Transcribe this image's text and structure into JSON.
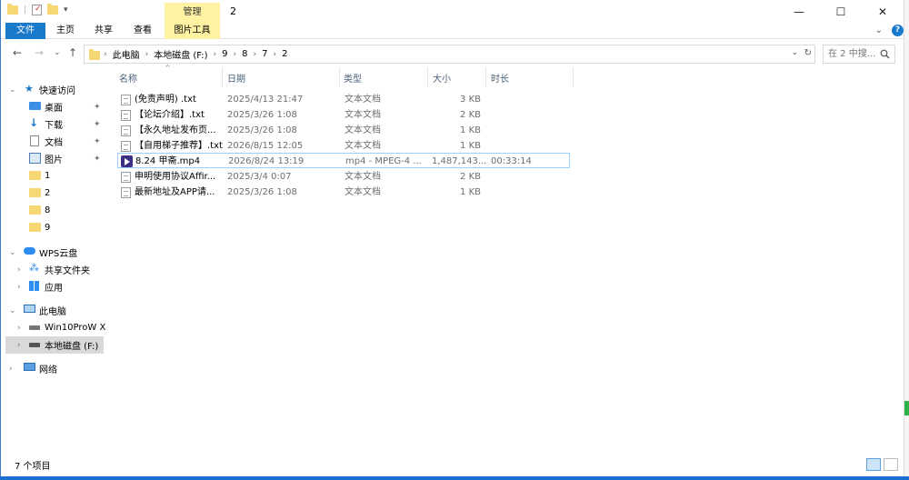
{
  "titlebar": {
    "context_tab_head": "管理",
    "title": "2",
    "minimize": "—",
    "maximize": "☐",
    "close": "✕"
  },
  "ribbon": {
    "tabs": [
      {
        "label": "文件"
      },
      {
        "label": "主页"
      },
      {
        "label": "共享"
      },
      {
        "label": "查看"
      },
      {
        "label": "图片工具"
      }
    ],
    "collapse": "⌄",
    "help": "?"
  },
  "nav": {
    "back": "←",
    "forward": "→",
    "recent": "⌄",
    "up": "↑",
    "breadcrumb": [
      "此电脑",
      "本地磁盘 (F:)",
      "9",
      "8",
      "7",
      "2"
    ],
    "separator": "›",
    "dropdown": "⌄",
    "refresh": "↻",
    "search_placeholder": "在 2 中搜..."
  },
  "sidebar": {
    "items": [
      {
        "label": "快速访问",
        "icon": "star-icon",
        "pinned": false
      },
      {
        "label": "桌面",
        "icon": "desktop-icon",
        "pinned": true
      },
      {
        "label": "下载",
        "icon": "download-icon",
        "pinned": true
      },
      {
        "label": "文档",
        "icon": "document-icon",
        "pinned": true
      },
      {
        "label": "图片",
        "icon": "picture-icon",
        "pinned": true
      },
      {
        "label": "1",
        "icon": "folder-icon",
        "pinned": false
      },
      {
        "label": "2",
        "icon": "folder-icon",
        "pinned": false
      },
      {
        "label": "8",
        "icon": "folder-icon",
        "pinned": false
      },
      {
        "label": "9",
        "icon": "folder-icon",
        "pinned": false
      },
      {
        "label": "WPS云盘",
        "icon": "cloud-icon",
        "pinned": false
      },
      {
        "label": "共享文件夹",
        "icon": "share-folder-icon",
        "pinned": false
      },
      {
        "label": "应用",
        "icon": "apps-icon",
        "pinned": false
      },
      {
        "label": "此电脑",
        "icon": "computer-icon",
        "pinned": false
      },
      {
        "label": "Win10ProW X",
        "icon": "drive-icon",
        "pinned": false
      },
      {
        "label": "本地磁盘 (F:)",
        "icon": "drive-icon",
        "pinned": false
      },
      {
        "label": "网络",
        "icon": "network-icon",
        "pinned": false
      }
    ],
    "pin_glyph": "📌"
  },
  "columns": {
    "name": "名称",
    "date": "日期",
    "type": "类型",
    "size": "大小",
    "duration": "时长"
  },
  "files": [
    {
      "name": "(免责声明) .txt",
      "date": "2025/4/13 21:47",
      "type": "文本文档",
      "size": "3 KB",
      "duration": ""
    },
    {
      "name": "【论坛介绍】.txt",
      "date": "2025/3/26 1:08",
      "type": "文本文档",
      "size": "2 KB",
      "duration": ""
    },
    {
      "name": "【永久地址发布页...",
      "date": "2025/3/26 1:08",
      "type": "文本文档",
      "size": "1 KB",
      "duration": ""
    },
    {
      "name": "【自用梯子推荐】.txt",
      "date": "2026/8/15 12:05",
      "type": "文本文档",
      "size": "1 KB",
      "duration": ""
    },
    {
      "name": "8.24 甲斋.mp4",
      "date": "2026/8/24 13:19",
      "type": "mp4 - MPEG-4 ...",
      "size": "1,487,143...",
      "duration": "00:33:14"
    },
    {
      "name": "申明使用协议Affir...",
      "date": "2025/3/4 0:07",
      "type": "文本文档",
      "size": "2 KB",
      "duration": ""
    },
    {
      "name": "最新地址及APP请...",
      "date": "2025/3/26 1:08",
      "type": "文本文档",
      "size": "1 KB",
      "duration": ""
    }
  ],
  "status": {
    "count": "7 个项目"
  },
  "colors": {
    "accent": "#1979ca",
    "context_tab": "#fff3a3",
    "selection_border": "#99d1ff"
  }
}
